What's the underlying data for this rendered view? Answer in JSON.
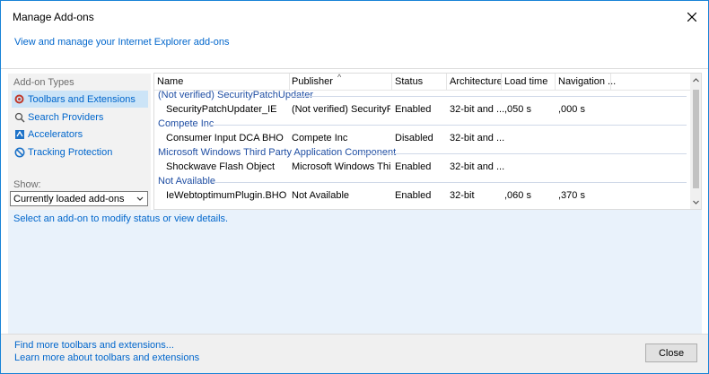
{
  "window": {
    "title": "Manage Add-ons"
  },
  "header": {
    "link": "View and manage your Internet Explorer add-ons"
  },
  "sidebar": {
    "heading": "Add-on Types",
    "items": [
      {
        "label": "Toolbars and Extensions",
        "icon": "gear-icon",
        "selected": true
      },
      {
        "label": "Search Providers",
        "icon": "search-icon",
        "selected": false
      },
      {
        "label": "Accelerators",
        "icon": "accelerator-icon",
        "selected": false
      },
      {
        "label": "Tracking Protection",
        "icon": "block-icon",
        "selected": false
      }
    ],
    "show_label": "Show:",
    "show_value": "Currently loaded add-ons"
  },
  "table": {
    "columns": [
      "Name",
      "Publisher",
      "Status",
      "Architecture",
      "Load time",
      "Navigation ..."
    ],
    "groups": [
      {
        "name": "(Not verified) SecurityPatchUpdater",
        "rows": [
          {
            "name": "SecurityPatchUpdater_IE",
            "publisher": "(Not verified) SecurityPat...",
            "status": "Enabled",
            "arch": "32-bit and ...",
            "load": ",050 s",
            "nav": ",000 s"
          }
        ]
      },
      {
        "name": "Compete Inc",
        "rows": [
          {
            "name": "Consumer Input DCA BHO",
            "publisher": "Compete Inc",
            "status": "Disabled",
            "arch": "32-bit and ...",
            "load": "",
            "nav": ""
          }
        ]
      },
      {
        "name": "Microsoft Windows Third Party Application Component",
        "rows": [
          {
            "name": "Shockwave Flash Object",
            "publisher": "Microsoft Windows Third...",
            "status": "Enabled",
            "arch": "32-bit and ...",
            "load": "",
            "nav": ""
          }
        ]
      },
      {
        "name": "Not Available",
        "rows": [
          {
            "name": "IeWebtoptimumPlugin.BHO",
            "publisher": "Not Available",
            "status": "Enabled",
            "arch": "32-bit",
            "load": ",060 s",
            "nav": ",370 s"
          }
        ]
      }
    ]
  },
  "status_text": "Select an add-on to modify status or view details.",
  "footer": {
    "link1": "Find more toolbars and extensions...",
    "link2": "Learn more about toolbars and extensions",
    "close_label": "Close"
  },
  "colors": {
    "accent": "#1883d7",
    "link": "#0066cc",
    "selected": "#cce4f7"
  }
}
